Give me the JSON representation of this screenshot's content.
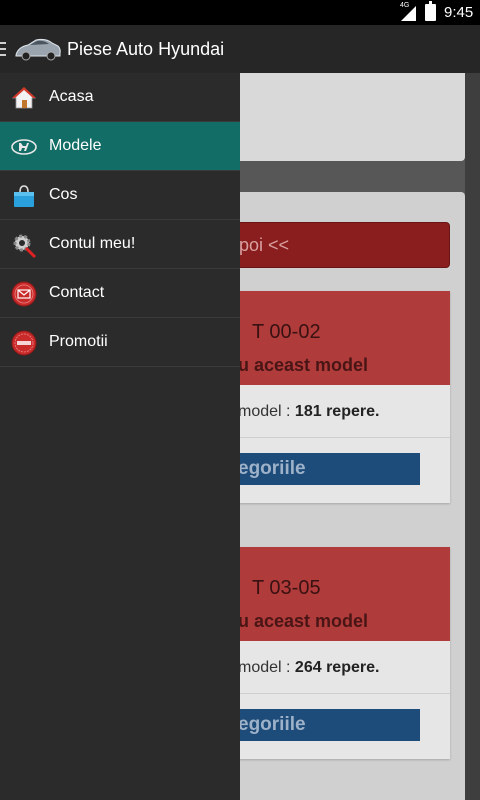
{
  "status_bar": {
    "network": "4G",
    "time": "9:45"
  },
  "action_bar": {
    "title": "Piese Auto Hyundai"
  },
  "drawer": {
    "items": [
      {
        "label": "Acasa",
        "icon": "home-icon"
      },
      {
        "label": "Modele",
        "icon": "hyundai-logo-icon",
        "active": true
      },
      {
        "label": "Cos",
        "icon": "shopping-bag-icon"
      },
      {
        "label": "Contul meu!",
        "icon": "settings-icon"
      },
      {
        "label": "Contact",
        "icon": "mail-icon"
      },
      {
        "label": "Promotii",
        "icon": "promo-badge-icon"
      }
    ]
  },
  "content": {
    "back_button": "poi <<",
    "models": [
      {
        "name": "T 00-02",
        "subtitle": "u aceast model",
        "count_prefix": "model : ",
        "count": "181 repere.",
        "button": "egoriile"
      },
      {
        "name": "T 03-05",
        "subtitle": "u aceast model",
        "count_prefix": "model : ",
        "count": "264 repere.",
        "button": "egoriile"
      }
    ]
  },
  "colors": {
    "accent": "#126d66",
    "drawer_bg": "#2b2b2b",
    "action_bar": "#262626",
    "model_header": "#b03b3b",
    "category_button": "#1d4b7a"
  }
}
